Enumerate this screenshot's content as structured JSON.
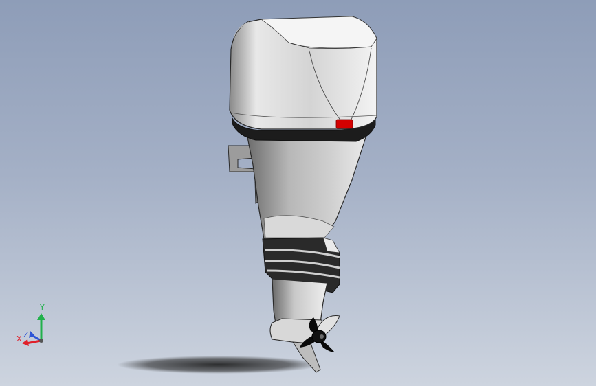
{
  "viewport": {
    "background_top": "#8e9db8",
    "background_bottom": "#cdd4df"
  },
  "model": {
    "subject": "outboard-motor",
    "body_color": "#d6d6d6",
    "band_color": "#1c1c1c",
    "indicator_color": "#d40000",
    "propeller_color": "#0a0a0a"
  },
  "triad": {
    "x_label": "X",
    "y_label": "Y",
    "z_label": "Z",
    "x_color": "#e0202a",
    "y_color": "#22b14c",
    "z_color": "#2e55d6"
  }
}
